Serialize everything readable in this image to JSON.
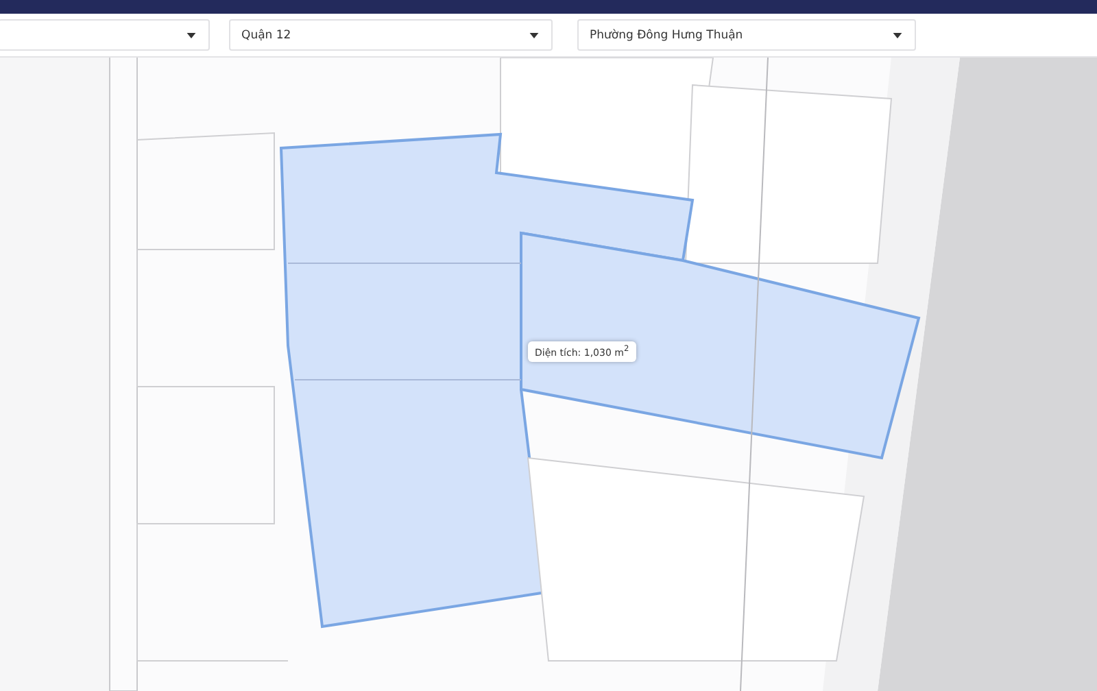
{
  "filters": [
    {
      "kind": "dropdown"
    },
    {
      "kind": "dropdown",
      "value": "Quận 12"
    },
    {
      "kind": "dropdown",
      "value": "Phường Đông Hưng Thuận"
    }
  ],
  "map": {
    "kind": "picture",
    "tooltip": "Diện tích: 1,030 m$^{2}$"
  }
}
